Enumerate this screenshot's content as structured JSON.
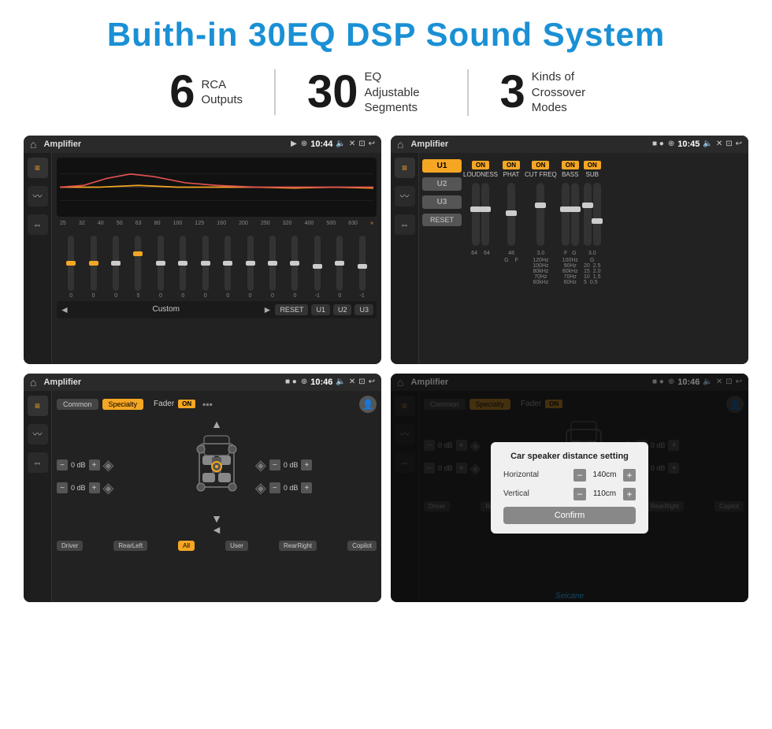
{
  "title": "Buith-in 30EQ DSP Sound System",
  "stats": [
    {
      "number": "6",
      "desc_line1": "RCA",
      "desc_line2": "Outputs"
    },
    {
      "number": "30",
      "desc_line1": "EQ Adjustable",
      "desc_line2": "Segments"
    },
    {
      "number": "3",
      "desc_line1": "Kinds of",
      "desc_line2": "Crossover Modes"
    }
  ],
  "screens": [
    {
      "id": "screen1",
      "status_bar": {
        "app": "Amplifier",
        "icons": "▶",
        "time": "10:44"
      },
      "type": "eq"
    },
    {
      "id": "screen2",
      "status_bar": {
        "app": "Amplifier",
        "icons": "■ ●",
        "time": "10:45"
      },
      "type": "amp"
    },
    {
      "id": "screen3",
      "status_bar": {
        "app": "Amplifier",
        "icons": "■ ●",
        "time": "10:46"
      },
      "type": "fader"
    },
    {
      "id": "screen4",
      "status_bar": {
        "app": "Amplifier",
        "icons": "■ ●",
        "time": "10:46"
      },
      "type": "fader_dialog",
      "dialog": {
        "title": "Car speaker distance setting",
        "horizontal_label": "Horizontal",
        "horizontal_value": "140cm",
        "vertical_label": "Vertical",
        "vertical_value": "110cm",
        "confirm_label": "Confirm"
      }
    }
  ],
  "eq": {
    "freqs": [
      "25",
      "32",
      "40",
      "50",
      "63",
      "80",
      "100",
      "125",
      "160",
      "200",
      "250",
      "320",
      "400",
      "500",
      "630"
    ],
    "values": [
      "0",
      "0",
      "0",
      "5",
      "0",
      "0",
      "0",
      "0",
      "0",
      "0",
      "0",
      "-1",
      "0",
      "-1"
    ],
    "presets": [
      "Custom",
      "RESET",
      "U1",
      "U2",
      "U3"
    ]
  },
  "amp": {
    "u_buttons": [
      "U1",
      "U2",
      "U3"
    ],
    "controls": [
      {
        "label": "LOUDNESS",
        "on": true
      },
      {
        "label": "PHAT",
        "on": true
      },
      {
        "label": "CUT FREQ",
        "on": true
      },
      {
        "label": "BASS",
        "on": true
      },
      {
        "label": "SUB",
        "on": true
      }
    ],
    "reset_label": "RESET"
  },
  "fader": {
    "tabs": [
      "Common",
      "Specialty"
    ],
    "fader_label": "Fader",
    "on_label": "ON",
    "locations": [
      "Driver",
      "RearLeft",
      "All",
      "User",
      "RearRight",
      "Copilot"
    ]
  },
  "watermark": "Seicane"
}
